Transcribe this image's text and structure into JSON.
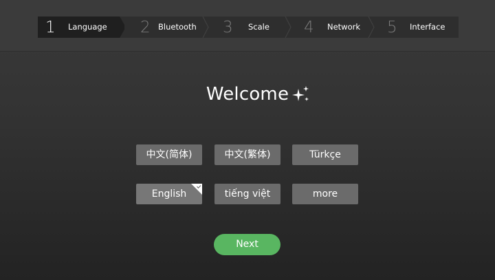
{
  "stepper": {
    "steps": [
      {
        "number": "1",
        "label": "Language",
        "active": true
      },
      {
        "number": "2",
        "label": "Bluetooth",
        "active": false
      },
      {
        "number": "3",
        "label": "Scale",
        "active": false
      },
      {
        "number": "4",
        "label": "Network",
        "active": false
      },
      {
        "number": "5",
        "label": "Interface",
        "active": false
      }
    ]
  },
  "welcome": {
    "title": "Welcome",
    "icon": "sparkle-icon"
  },
  "languages": [
    {
      "label": "中文(简体)",
      "selected": false
    },
    {
      "label": "中文(繁体)",
      "selected": false
    },
    {
      "label": "Türkçe",
      "selected": false
    },
    {
      "label": "English",
      "selected": true
    },
    {
      "label": "tiếng việt",
      "selected": false
    },
    {
      "label": "more",
      "selected": false
    }
  ],
  "next_button": {
    "label": "Next"
  },
  "colors": {
    "accent_green": "#59b661",
    "button_gray": "#6b6b6b",
    "step_active_bg": "#1f1f1f"
  }
}
